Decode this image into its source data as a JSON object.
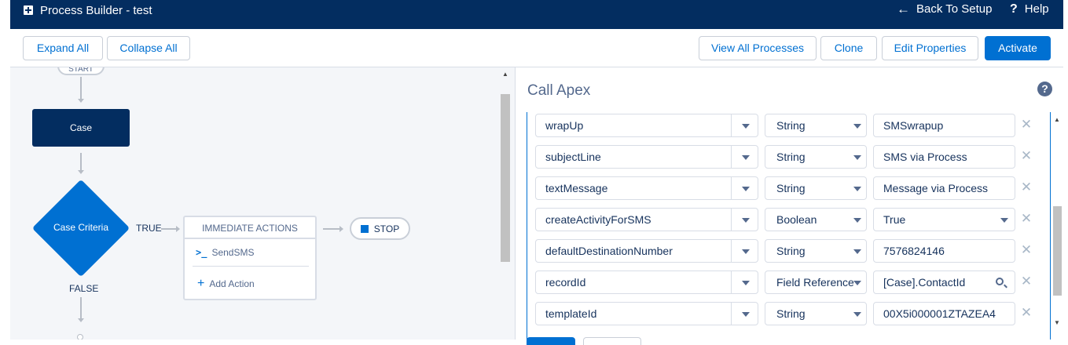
{
  "header": {
    "title": "Process Builder - test",
    "back_label": "Back To Setup",
    "help_label": "Help"
  },
  "toolbar": {
    "expand_all": "Expand All",
    "collapse_all": "Collapse All",
    "view_all_processes": "View All Processes",
    "clone": "Clone",
    "edit_properties": "Edit Properties",
    "activate": "Activate"
  },
  "canvas": {
    "start_label": "START",
    "object_node": "Case",
    "criteria_node": "Case Criteria",
    "true_label": "TRUE",
    "false_label": "FALSE",
    "immediate_actions_header": "IMMEDIATE ACTIONS",
    "action_item": "SendSMS",
    "add_action": "Add Action",
    "stop_label": "STOP"
  },
  "panel": {
    "title": "Call Apex",
    "rows": [
      {
        "field": "wrapUp",
        "type": "String",
        "value": "SMSwrapup"
      },
      {
        "field": "subjectLine",
        "type": "String",
        "value": "SMS via Process"
      },
      {
        "field": "textMessage",
        "type": "String",
        "value": "Message via Process"
      },
      {
        "field": "createActivityForSMS",
        "type": "Boolean",
        "value": "True"
      },
      {
        "field": "defaultDestinationNumber",
        "type": "String",
        "value": "7576824146"
      },
      {
        "field": "recordId",
        "type": "Field Reference",
        "value": "[Case].ContactId"
      },
      {
        "field": "templateId",
        "type": "String",
        "value": "00X5i000001ZTAZEA4"
      }
    ]
  },
  "colors": {
    "header_bg": "#032d60",
    "brand": "#0070d2",
    "canvas_bg": "#f4f6f9"
  }
}
